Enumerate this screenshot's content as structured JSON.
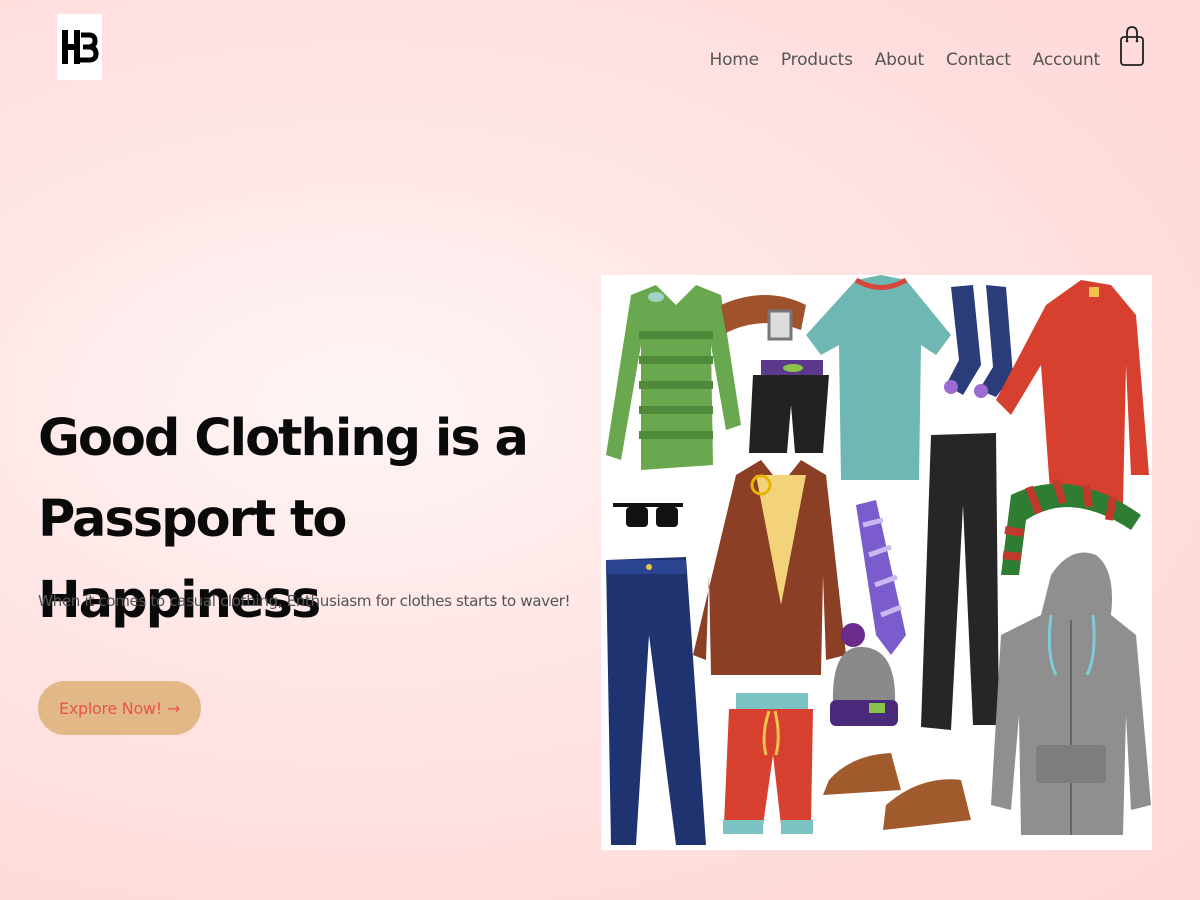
{
  "brand": {
    "logo_text": "HB"
  },
  "nav": {
    "items": [
      {
        "label": "Home"
      },
      {
        "label": "Products"
      },
      {
        "label": "About"
      },
      {
        "label": "Contact"
      },
      {
        "label": "Account"
      }
    ],
    "cart_icon": "shopping-bag-icon"
  },
  "hero": {
    "title_line1": "Good Clothing is a",
    "title_line2": "Passport to Happiness",
    "subtitle": "When it comes to casual clothing, Enthusiasm for clothes starts to waver!",
    "cta_label": "Explore Now!",
    "cta_arrow": "→"
  },
  "colors": {
    "cta_bg": "#e2b986",
    "cta_text": "#e8544e",
    "background": "#ffe3e3"
  }
}
